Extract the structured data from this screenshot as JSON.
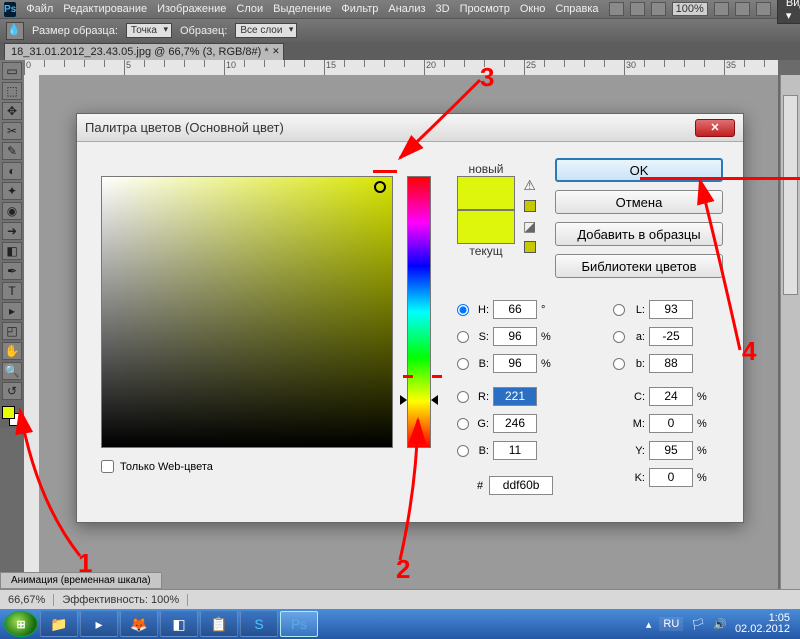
{
  "menubar": {
    "items": [
      "Файл",
      "Редактирование",
      "Изображение",
      "Слои",
      "Выделение",
      "Фильтр",
      "Анализ",
      "3D",
      "Просмотр",
      "Окно",
      "Справка"
    ],
    "zoom": "100%",
    "video_label": "Видео"
  },
  "optionsbar": {
    "sample_label": "Размер образца:",
    "sample_value": "Точка",
    "sample2_label": "Образец:",
    "sample2_value": "Все слои"
  },
  "tab": {
    "label": "18_31.01.2012_23.43.05.jpg @ 66,7% (3, RGB/8#) *"
  },
  "tools": [
    "▭",
    "⬚",
    "✥",
    "✂",
    "✎",
    "◐",
    "✦",
    "◉",
    "➜",
    "◧",
    "✒",
    "T",
    "▸",
    "◰",
    "✋",
    "🔍",
    "↺",
    "◧"
  ],
  "fg_color": "#e5ff00",
  "bg_color": "#ffffff",
  "statusbar": {
    "zoom": "66,67%",
    "eff": "Эффективность: 100%"
  },
  "anim_tab": "Анимация (временная шкала)",
  "dialog": {
    "title": "Палитра цветов (Основной цвет)",
    "new_label": "новый",
    "current_label": "текущ",
    "webonly": "Только Web-цвета",
    "buttons": {
      "ok": "OK",
      "cancel": "Отмена",
      "add": "Добавить в образцы",
      "libs": "Библиотеки цветов"
    },
    "fields": {
      "H": "66",
      "H_unit": "°",
      "S": "96",
      "S_unit": "%",
      "B": "96",
      "B_unit": "%",
      "R": "221",
      "G": "246",
      "Bb": "11",
      "L": "93",
      "a": "-25",
      "b": "88",
      "C": "24",
      "C_unit": "%",
      "M": "0",
      "M_unit": "%",
      "Y": "95",
      "Y_unit": "%",
      "K": "0",
      "K_unit": "%",
      "hex": "ddf60b"
    }
  },
  "annotations": {
    "n1": "1",
    "n2": "2",
    "n3": "3",
    "n4": "4"
  },
  "taskbar": {
    "lang": "RU",
    "time": "1:05",
    "date": "02.02.2012"
  }
}
